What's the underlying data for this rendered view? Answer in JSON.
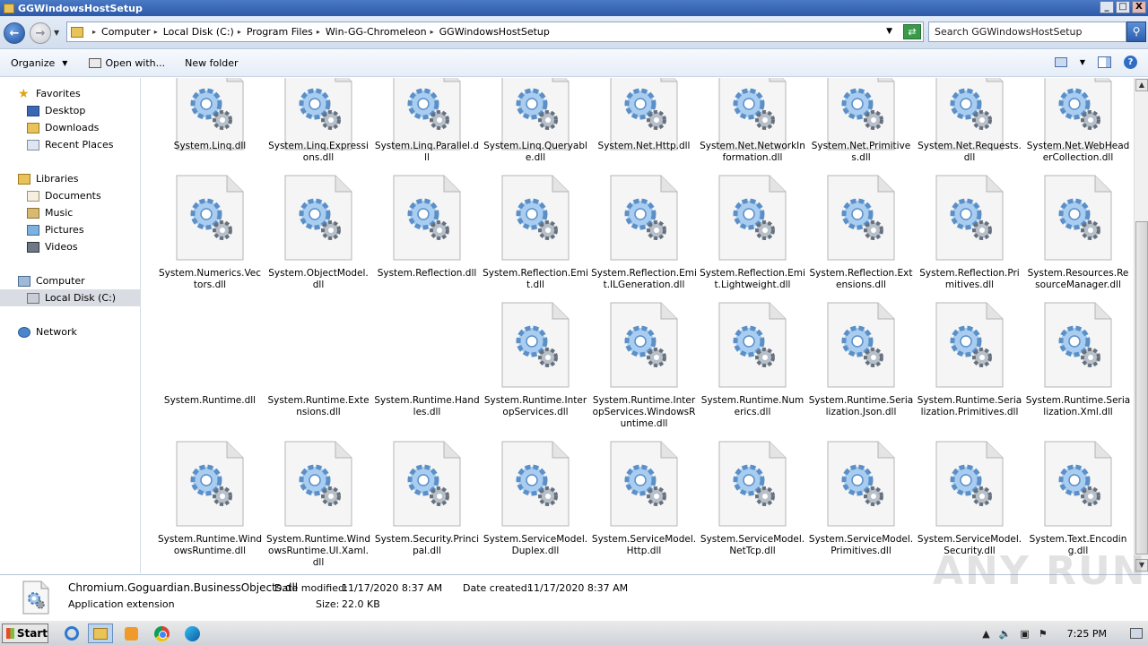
{
  "window": {
    "title": "GGWindowsHostSetup",
    "minimize_label": "_",
    "restore_label": "□",
    "close_label": "X"
  },
  "address": {
    "crumbs": [
      "Computer",
      "Local Disk (C:)",
      "Program Files",
      "Win-GG-Chromeleon",
      "GGWindowsHostSetup"
    ],
    "search_placeholder": "Search GGWindowsHostSetup"
  },
  "toolbar": {
    "organize_label": "Organize",
    "open_with_label": "Open with...",
    "new_folder_label": "New folder"
  },
  "nav": {
    "favorites_label": "Favorites",
    "favorites": [
      "Desktop",
      "Downloads",
      "Recent Places"
    ],
    "libraries_label": "Libraries",
    "libraries": [
      "Documents",
      "Music",
      "Pictures",
      "Videos"
    ],
    "computer_label": "Computer",
    "computer_items": [
      "Local Disk (C:)"
    ],
    "network_label": "Network"
  },
  "files": [
    [
      "System.Linq.dll",
      "System.Linq.Expressions.dll",
      "System.Linq.Parallel.dll",
      "System.Linq.Queryable.dll",
      "System.Net.Http.dll",
      "System.Net.NetworkInformation.dll",
      "System.Net.Primitives.dll",
      "System.Net.Requests.dll",
      "System.Net.WebHeaderCollection.dll"
    ],
    [
      "System.Numerics.Vectors.dll",
      "System.ObjectModel.dll",
      "System.Reflection.dll",
      "System.Reflection.Emit.dll",
      "System.Reflection.Emit.ILGeneration.dll",
      "System.Reflection.Emit.Lightweight.dll",
      "System.Reflection.Extensions.dll",
      "System.Reflection.Primitives.dll",
      "System.Resources.ResourceManager.dll"
    ],
    [
      "System.Runtime.dll",
      "System.Runtime.Extensions.dll",
      "System.Runtime.Handles.dll",
      "System.Runtime.InteropServices.dll",
      "System.Runtime.InteropServices.WindowsRuntime.dll",
      "System.Runtime.Numerics.dll",
      "System.Runtime.Serialization.Json.dll",
      "System.Runtime.Serialization.Primitives.dll",
      "System.Runtime.Serialization.Xml.dll"
    ],
    [
      "System.Runtime.WindowsRuntime.dll",
      "System.Runtime.WindowsRuntime.UI.Xaml.dll",
      "System.Security.Principal.dll",
      "System.ServiceModel.Duplex.dll",
      "System.ServiceModel.Http.dll",
      "System.ServiceModel.NetTcp.dll",
      "System.ServiceModel.Primitives.dll",
      "System.ServiceModel.Security.dll",
      "System.Text.Encoding.dll"
    ]
  ],
  "details": {
    "filename": "Chromium.Goguardian.BusinessObjects.dll",
    "type": "Application extension",
    "modified_label": "Date modified:",
    "modified_value": "11/17/2020 8:37 AM",
    "created_label": "Date created:",
    "created_value": "11/17/2020 8:37 AM",
    "size_label": "Size:",
    "size_value": "22.0 KB"
  },
  "taskbar": {
    "start_label": "Start",
    "clock": "7:25 PM"
  },
  "watermark": "ANY RUN"
}
